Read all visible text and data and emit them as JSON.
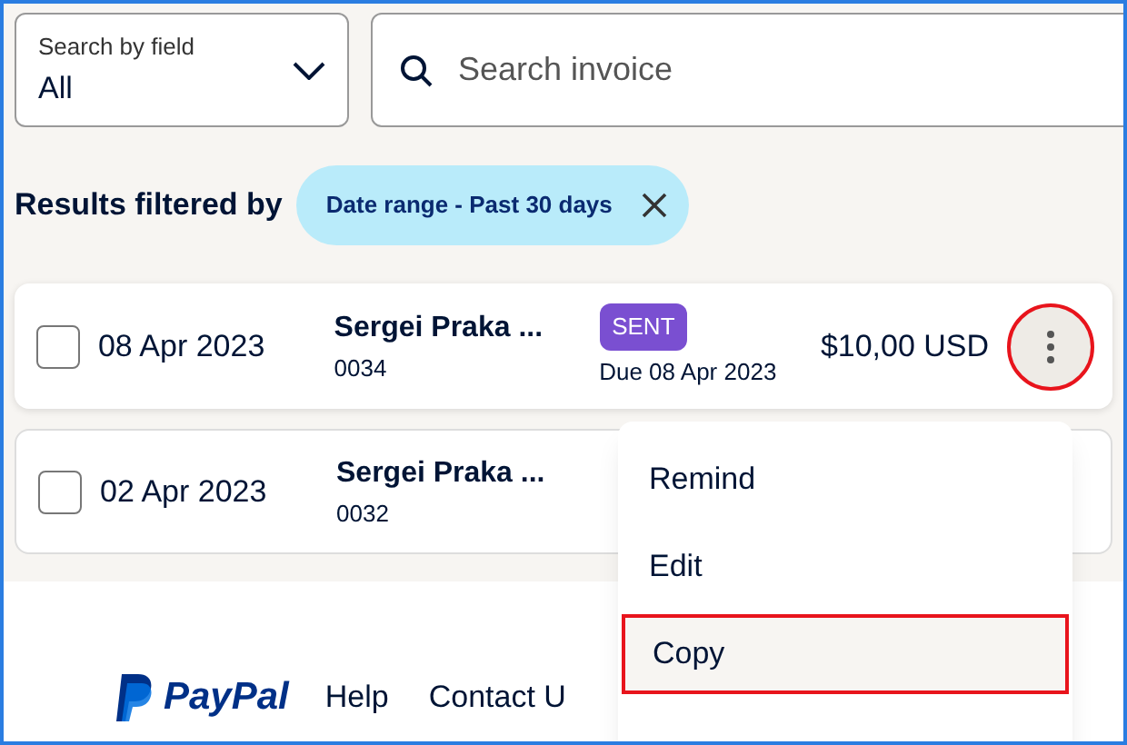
{
  "search_field_select": {
    "label": "Search by field",
    "value": "All"
  },
  "search": {
    "placeholder": "Search invoice"
  },
  "filters": {
    "label": "Results filtered by",
    "chips": [
      {
        "label": "Date range - Past 30 days"
      }
    ]
  },
  "invoices": [
    {
      "checked": false,
      "date": "08 Apr 2023",
      "customer": "Sergei Praka ...",
      "number": "0034",
      "status": "SENT",
      "due": "Due 08 Apr 2023",
      "amount": "$10,00 USD",
      "menu_open": true
    },
    {
      "checked": false,
      "date": "02 Apr 2023",
      "customer": "Sergei Praka ...",
      "number": "0032"
    }
  ],
  "menu": {
    "items": [
      {
        "label": "Remind",
        "selected": false
      },
      {
        "label": "Edit",
        "selected": false
      },
      {
        "label": "Copy",
        "selected": true
      }
    ]
  },
  "footer": {
    "logo": "PayPal",
    "links": [
      "Help",
      "Contact U"
    ]
  }
}
